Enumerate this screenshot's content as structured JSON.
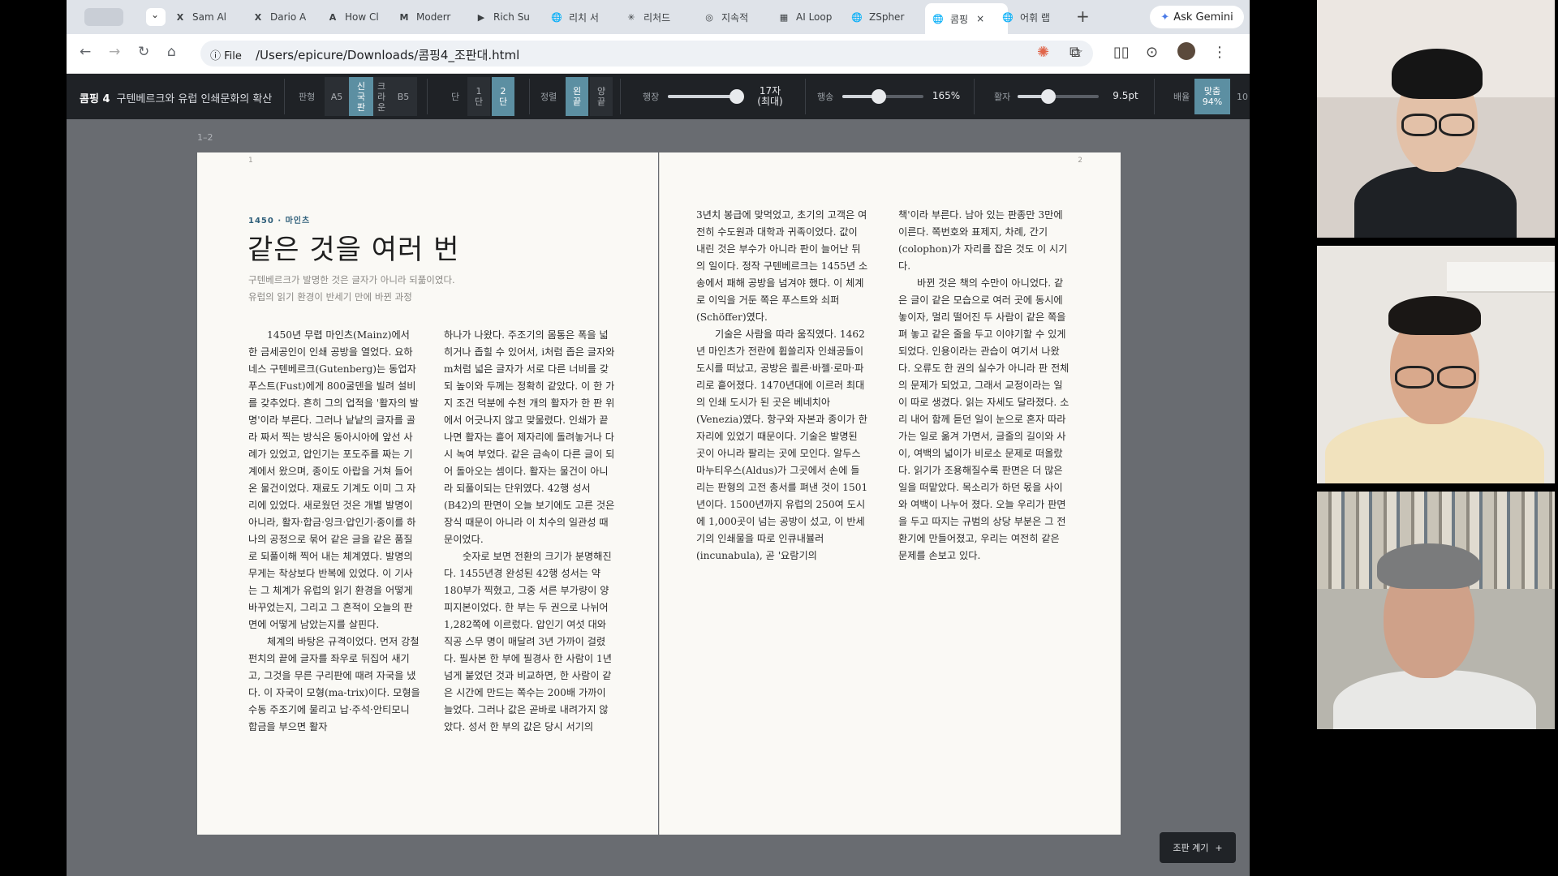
{
  "browser": {
    "tabs": [
      {
        "label": "Sam Al",
        "icon": "X"
      },
      {
        "label": "Dario A",
        "icon": "X"
      },
      {
        "label": "How Cl",
        "icon": "A"
      },
      {
        "label": "Moderr",
        "icon": "M"
      },
      {
        "label": "Rich Su",
        "icon": "▶"
      },
      {
        "label": "리치 서",
        "icon": "🌐"
      },
      {
        "label": "리처드 ",
        "icon": "✳"
      },
      {
        "label": "지속적",
        "icon": "◎"
      },
      {
        "label": "AI Loop",
        "icon": "▦"
      },
      {
        "label": "ZSpher",
        "icon": "🌐"
      },
      {
        "label": "콤핑",
        "icon": "🌐",
        "active": true
      },
      {
        "label": "어휘 랩",
        "icon": "🌐"
      }
    ],
    "new_tab": "+",
    "close_tab": "×",
    "gemini_label": "Ask Gemini",
    "file_chip": "File",
    "url": "/Users/epicure/Downloads/콤핑4_조판대.html"
  },
  "toolbar": {
    "doc_number": "콤핑 4",
    "doc_title": "구텐베르크와 유럽 인쇄문화의 확산",
    "format_label": "판형",
    "format_options": [
      "A5",
      "신국판",
      "크라운",
      "B5"
    ],
    "columns_label": "단",
    "columns_options": [
      "1단",
      "2단"
    ],
    "align_label": "정렬",
    "align_options": [
      "왼끝",
      "양끝"
    ],
    "line_length_label": "행장",
    "line_length_value": "17자",
    "line_length_note": "(최대)",
    "line_length_level": 0.92,
    "leading_label": "행송",
    "leading_value": "165%",
    "leading_level": 0.45,
    "size_label": "활자",
    "size_value": "9.5pt",
    "size_level": 0.38,
    "zoom_label": "배율",
    "zoom_fit": "맞춤",
    "zoom_value": "94%",
    "zoom_next": "10"
  },
  "spread_label": "1–2",
  "page_left": {
    "number": "1",
    "eyebrow": "1450 · 마인츠",
    "title": "같은 것을 여러 번",
    "subtitle_lines": [
      "구텐베르크가 발명한 것은 글자가 아니라 되풂이였다.",
      "유럽의 읽기 환경이 반세기 만에 바뀐 과정"
    ],
    "col1": [
      "1450년 무렵 마인츠(Mainz)에서 한 금세공인이 인쇄 공방을 열었다. 요하네스 구텐베르크(Gutenberg)는 동업자 푸스트(Fust)에게 800굴덴을 빌려 설비를 갖추었다. 흔히 그의 업적을 '활자의 발명'이라 부른다. 그러나 낱낱의 글자를 골라 짜서 찍는 방식은 동아시아에 앞선 사례가 있었고, 압인기는 포도주를 짜는 기계에서 왔으며, 종이도 아랍을 거쳐 들어온 물건이었다. 재료도 기계도 이미 그 자리에 있었다. 새로웠던 것은 개별 발명이 아니라, 활자·합금·잉크·압인기·종이를 하나의 공정으로 묶어 같은 글을 같은 품질로 되풀이해 찍어 내는 체계였다. 발명의 무게는 착상보다 반복에 있었다. 이 기사는 그 체계가 유럽의 읽기 환경을 어떻게 바꾸었는지, 그리고 그 흔적이 오늘의 판면에 어떻게 남았는지를 살핀다.",
      "체계의 바탕은 규격이었다. 먼저 강철 펀치의 끝에 글자를 좌우로 뒤집어 새기고, 그것을 무른 구리판에 때려 자국을 냈다. 이 자국이 모형(ma-trix)이다. 모형을 수동 주조기에 물리고 납·주석·안티모니 합금을 부으면 활자"
    ],
    "col2": [
      "하나가 나왔다. 주조기의 몸통은 폭을 넓히거나 좁힐 수 있어서, i처럼 좁은 글자와 m처럼 넓은 글자가 서로 다른 너비를 갖되 높이와 두께는 정확히 같았다. 이 한 가지 조건 덕분에 수천 개의 활자가 한 판 위에서 어긋나지 않고 맞물렸다. 인쇄가 끝나면 활자는 흩어 제자리에 돌려놓거나 다시 녹여 부었다. 같은 금속이 다른 글이 되어 돌아오는 셈이다. 활자는 물건이 아니라 되풀이되는 단위였다. 42행 성서(B42)의 판면이 오늘 보기에도 고른 것은 장식 때문이 아니라 이 치수의 일관성 때문이었다.",
      "숫자로 보면 전환의 크기가 분명해진다. 1455년경 완성된 42행 성서는 약 180부가 찍혔고, 그중 서른 부가량이 양피지본이었다. 한 부는 두 권으로 나뉘어 1,282쪽에 이르렀다. 압인기 여섯 대와 직공 스무 명이 매달려 3년 가까이 걸렸다. 필사본 한 부에 필경사 한 사람이 1년 넘게 붙었던 것과 비교하면, 한 사람이 같은 시간에 만드는 쪽수는 200배 가까이 늘었다. 그러나 값은 곧바로 내려가지 않았다. 성서 한 부의 값은 당시 서기의"
    ]
  },
  "page_right": {
    "number": "2",
    "col1": [
      "3년치 봉급에 맞먹었고, 초기의 고객은 여전히 수도원과 대학과 귀족이었다. 값이 내린 것은 부수가 아니라 판이 늘어난 뒤의 일이다. 정작 구텐베르크는 1455년 소송에서 패해 공방을 넘겨야 했다. 이 체계로 이익을 거둔 쪽은 푸스트와 쇠퍼(Schöffer)였다.",
      "기술은 사람을 따라 움직였다. 1462년 마인츠가 전란에 휩쓸리자 인쇄공들이 도시를 떠났고, 공방은 쾰른·바젤·로마·파리로 흩어졌다. 1470년대에 이르러 최대의 인쇄 도시가 된 곳은 베네치아(Venezia)였다. 항구와 자본과 종이가 한자리에 있었기 때문이다. 기술은 발명된 곳이 아니라 팔리는 곳에 모인다. 알두스 마누티우스(Aldus)가 그곳에서 손에 들리는 판형의 고전 총서를 펴낸 것이 1501년이다. 1500년까지 유럽의 250여 도시에 1,000곳이 넘는 공방이 섰고, 이 반세기의 인쇄물을 따로 인큐내뷸러(incunabula), 곧 '요람기의"
    ],
    "col2": [
      "책'이라 부른다. 남아 있는 판종만 3만에 이른다. 쪽번호와 표제지, 차례, 간기(colophon)가 자리를 잡은 것도 이 시기다.",
      "바뀐 것은 책의 수만이 아니었다. 같은 글이 같은 모습으로 여러 곳에 동시에 놓이자, 멀리 떨어진 두 사람이 같은 쪽을 펴 놓고 같은 줄을 두고 이야기할 수 있게 되었다. 인용이라는 관습이 여기서 나왔다. 오류도 한 권의 실수가 아니라 판 전체의 문제가 되었고, 그래서 교정이라는 일이 따로 생겼다. 읽는 자세도 달라졌다. 소리 내어 함께 듣던 일이 눈으로 혼자 따라가는 일로 옮겨 가면서, 글줄의 길이와 사이, 여백의 넓이가 비로소 문제로 떠올랐다. 읽기가 조용해질수록 판면은 더 많은 일을 떠맡았다. 목소리가 하던 몫을 사이와 여백이 나누어 졌다. 오늘 우리가 판면을 두고 따지는 규범의 상당 부분은 그 전환기에 만들어졌고, 우리는 여전히 같은 문제를 손보고 있다."
    ]
  },
  "fab_label": "조판 계기",
  "fab_icon": "+",
  "colors": {
    "accent": "#5c8fa2",
    "toolbar_bg": "#1f2226",
    "workspace_bg": "#696c71",
    "page_bg": "#faf9f5"
  }
}
